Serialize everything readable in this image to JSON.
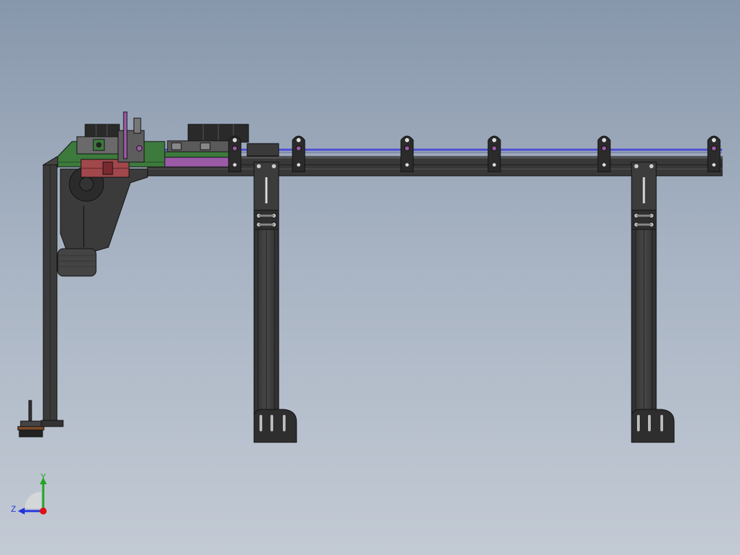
{
  "viewport": {
    "background_top": "#8797ab",
    "background_bottom": "#c3cad4"
  },
  "model": {
    "part_colors": {
      "frame": "#3a3a3a",
      "frame_edge": "#111111",
      "frame_light": "#4d4d4d",
      "motor": "#444444",
      "green_plate": "#3d7a3d",
      "red_block": "#a0484b",
      "purple_part": "#9a5aa6",
      "blue_rail": "#4b4bd6"
    },
    "icons": [
      "gearmotor-icon",
      "leveling-foot-icon",
      "clamp-bracket-icon"
    ]
  },
  "triad": {
    "y_label": "Y",
    "z_label": "Z",
    "y_color": "#1fa51f",
    "z_color": "#2233dd",
    "x_dot_color": "#dd1111"
  }
}
